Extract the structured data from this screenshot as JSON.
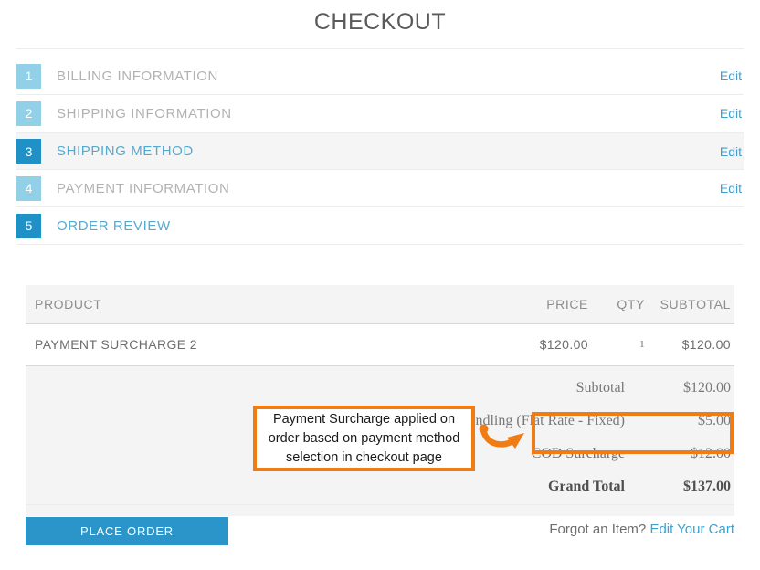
{
  "page": {
    "title": "CHECKOUT"
  },
  "steps": [
    {
      "num": "1",
      "label": "BILLING INFORMATION",
      "edit": "Edit",
      "state": "pending"
    },
    {
      "num": "2",
      "label": "SHIPPING INFORMATION",
      "edit": "Edit",
      "state": "pending"
    },
    {
      "num": "3",
      "label": "SHIPPING METHOD",
      "edit": "Edit",
      "state": "active"
    },
    {
      "num": "4",
      "label": "PAYMENT INFORMATION",
      "edit": "Edit",
      "state": "pending"
    },
    {
      "num": "5",
      "label": "ORDER REVIEW",
      "edit": "",
      "state": "done"
    }
  ],
  "order_table": {
    "headers": {
      "product": "PRODUCT",
      "price": "PRICE",
      "qty": "QTY",
      "subtotal": "SUBTOTAL"
    },
    "rows": [
      {
        "product": "PAYMENT SURCHARGE 2",
        "price": "$120.00",
        "qty": "1",
        "subtotal": "$120.00"
      }
    ]
  },
  "totals": [
    {
      "label": "Subtotal",
      "value": "$120.00",
      "emphasis": "normal"
    },
    {
      "label": "Shipping & Handling (Flat Rate - Fixed)",
      "value": "$5.00",
      "emphasis": "normal"
    },
    {
      "label": "COD Surcharge",
      "value": "$12.00",
      "emphasis": "highlight"
    },
    {
      "label": "Grand Total",
      "value": "$137.00",
      "emphasis": "grand"
    }
  ],
  "annotation": {
    "text": "Payment Surcharge applied on order based on payment method selection in checkout page"
  },
  "footer": {
    "place_order_label": "PLACE ORDER",
    "forgot_text": "Forgot an Item?",
    "edit_cart_label": "Edit Your Cart"
  },
  "colors": {
    "accent_blue": "#2b95ca",
    "link_blue": "#3e9fd0",
    "step_pending": "#92d0e7",
    "step_active": "#1f91c6",
    "annotation_orange": "#ef7c14"
  }
}
